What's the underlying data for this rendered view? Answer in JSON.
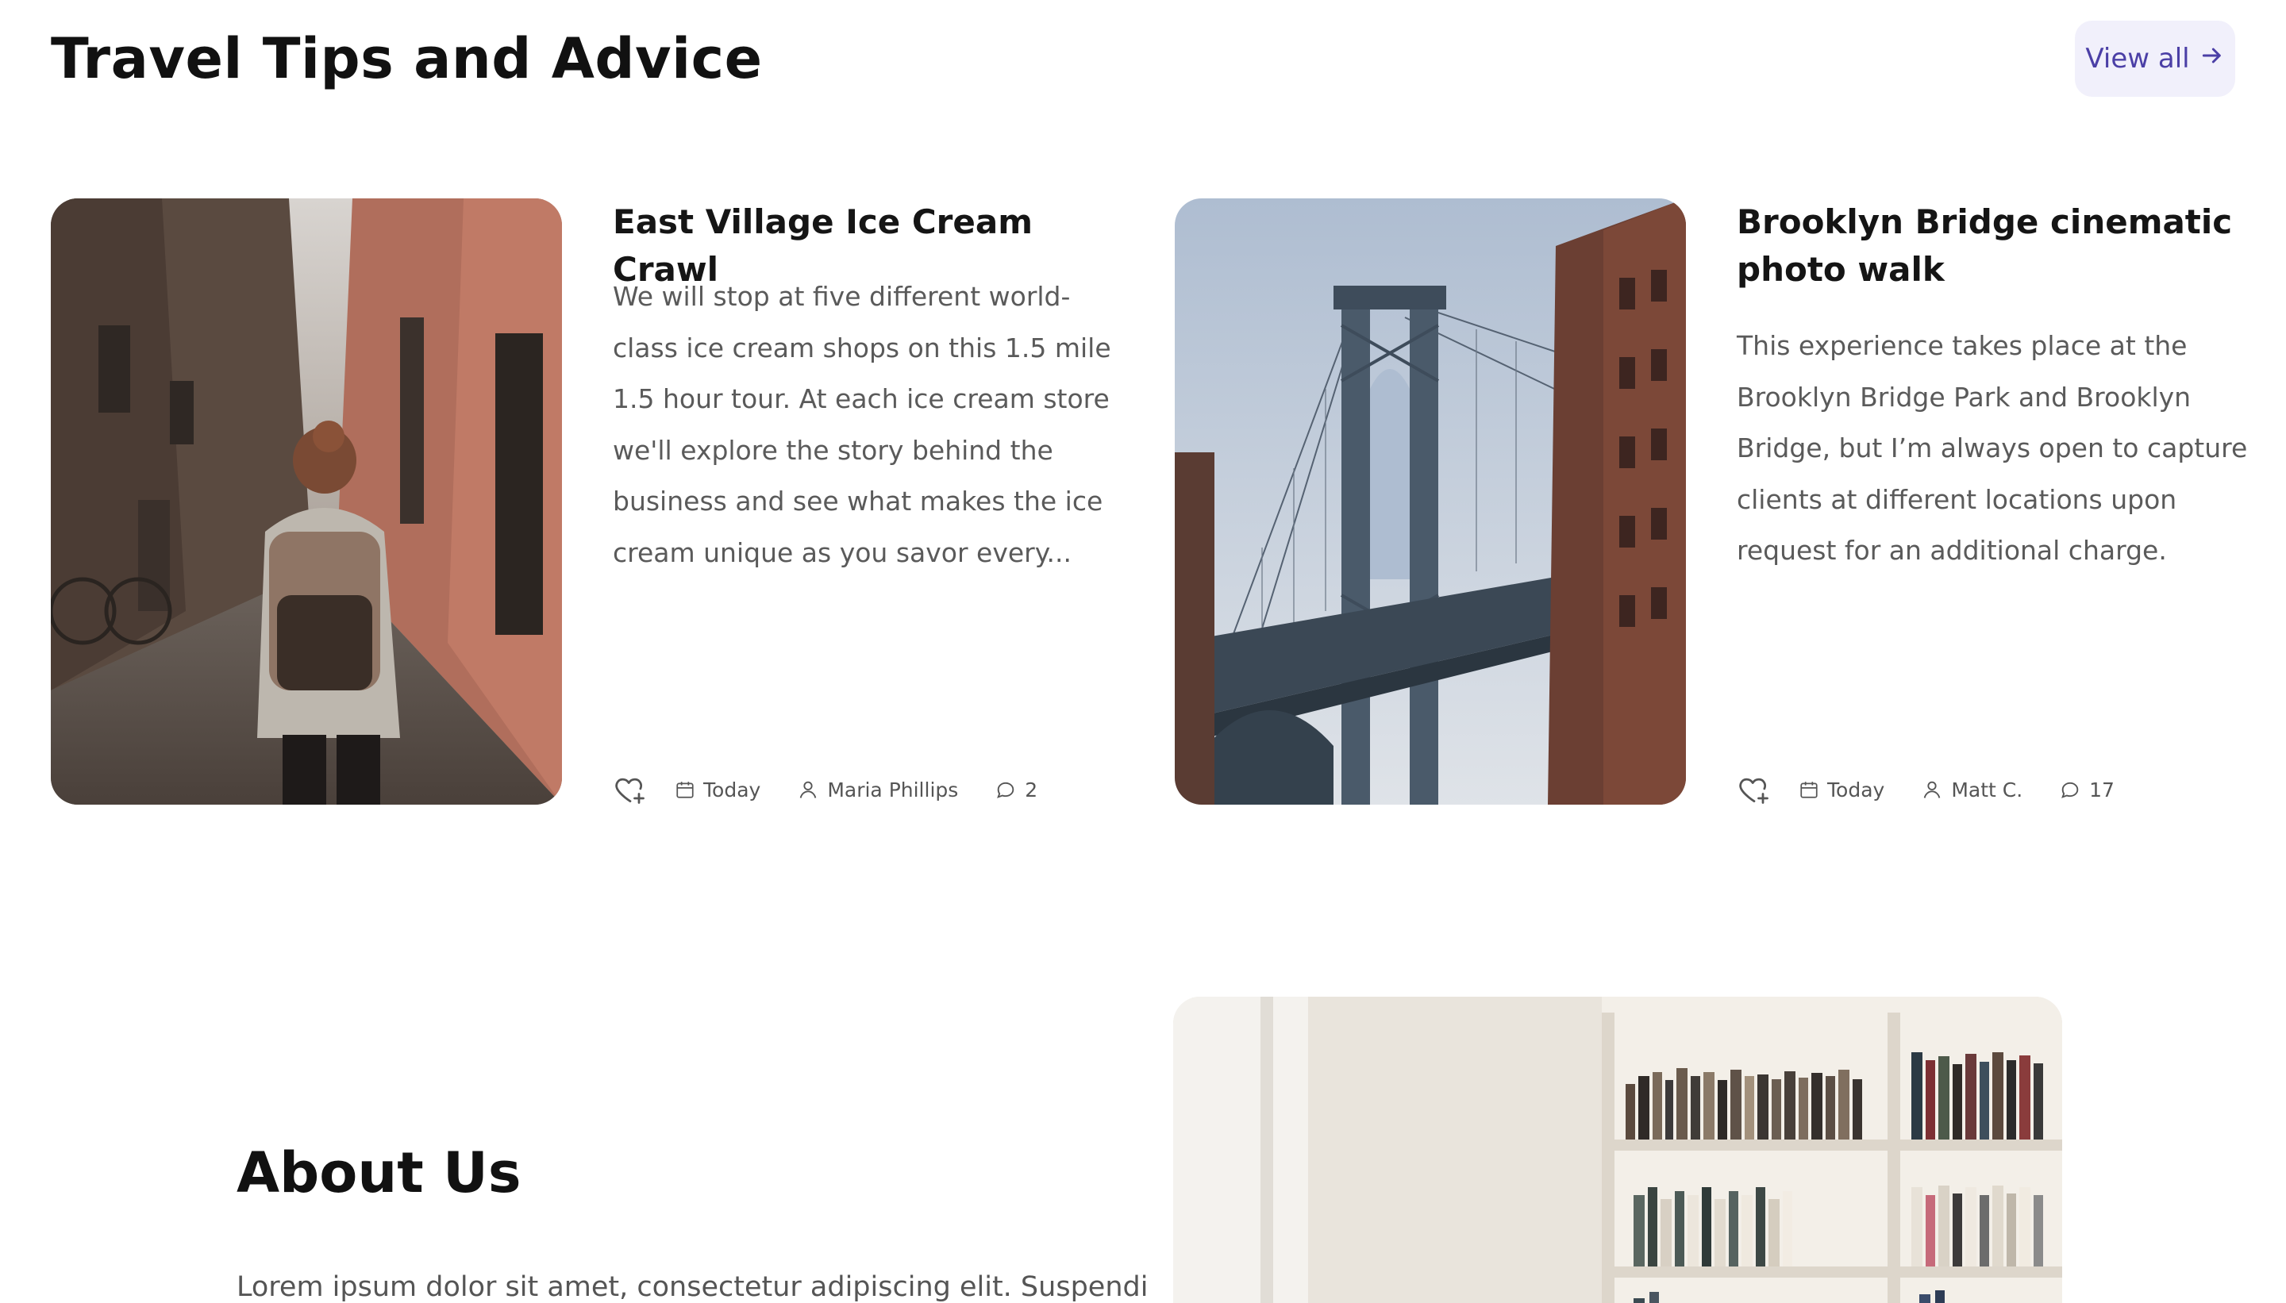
{
  "section": {
    "title": "Travel Tips and Advice",
    "view_all_label": "View all"
  },
  "posts": [
    {
      "title": "East Village Ice Cream Crawl",
      "description": "We will stop at five different world-class ice cream shops on this 1.5 mile 1.5 hour tour. At each ice cream store we'll explore the story behind the business and see what makes the ice cream unique as you savor every...",
      "date": "Today",
      "author": "Maria Phillips",
      "comments": "2",
      "image_icon": "alley-photo"
    },
    {
      "title": "Brooklyn Bridge cinematic photo walk",
      "description": "This experience takes place at the Brooklyn Bridge Park and Brooklyn Bridge, but I’m always open to capture clients at different locations upon request for an additional charge.",
      "date": "Today",
      "author": "Matt C.",
      "comments": "17",
      "image_icon": "bridge-photo"
    }
  ],
  "about": {
    "title": "About Us",
    "text": "Lorem ipsum dolor sit amet, consectetur adipiscing elit. Suspendisse"
  },
  "colors": {
    "accent": "#4b3fa6",
    "accent_bg": "#f1f0fb",
    "text": "#111111",
    "muted": "#5a5a5a"
  }
}
